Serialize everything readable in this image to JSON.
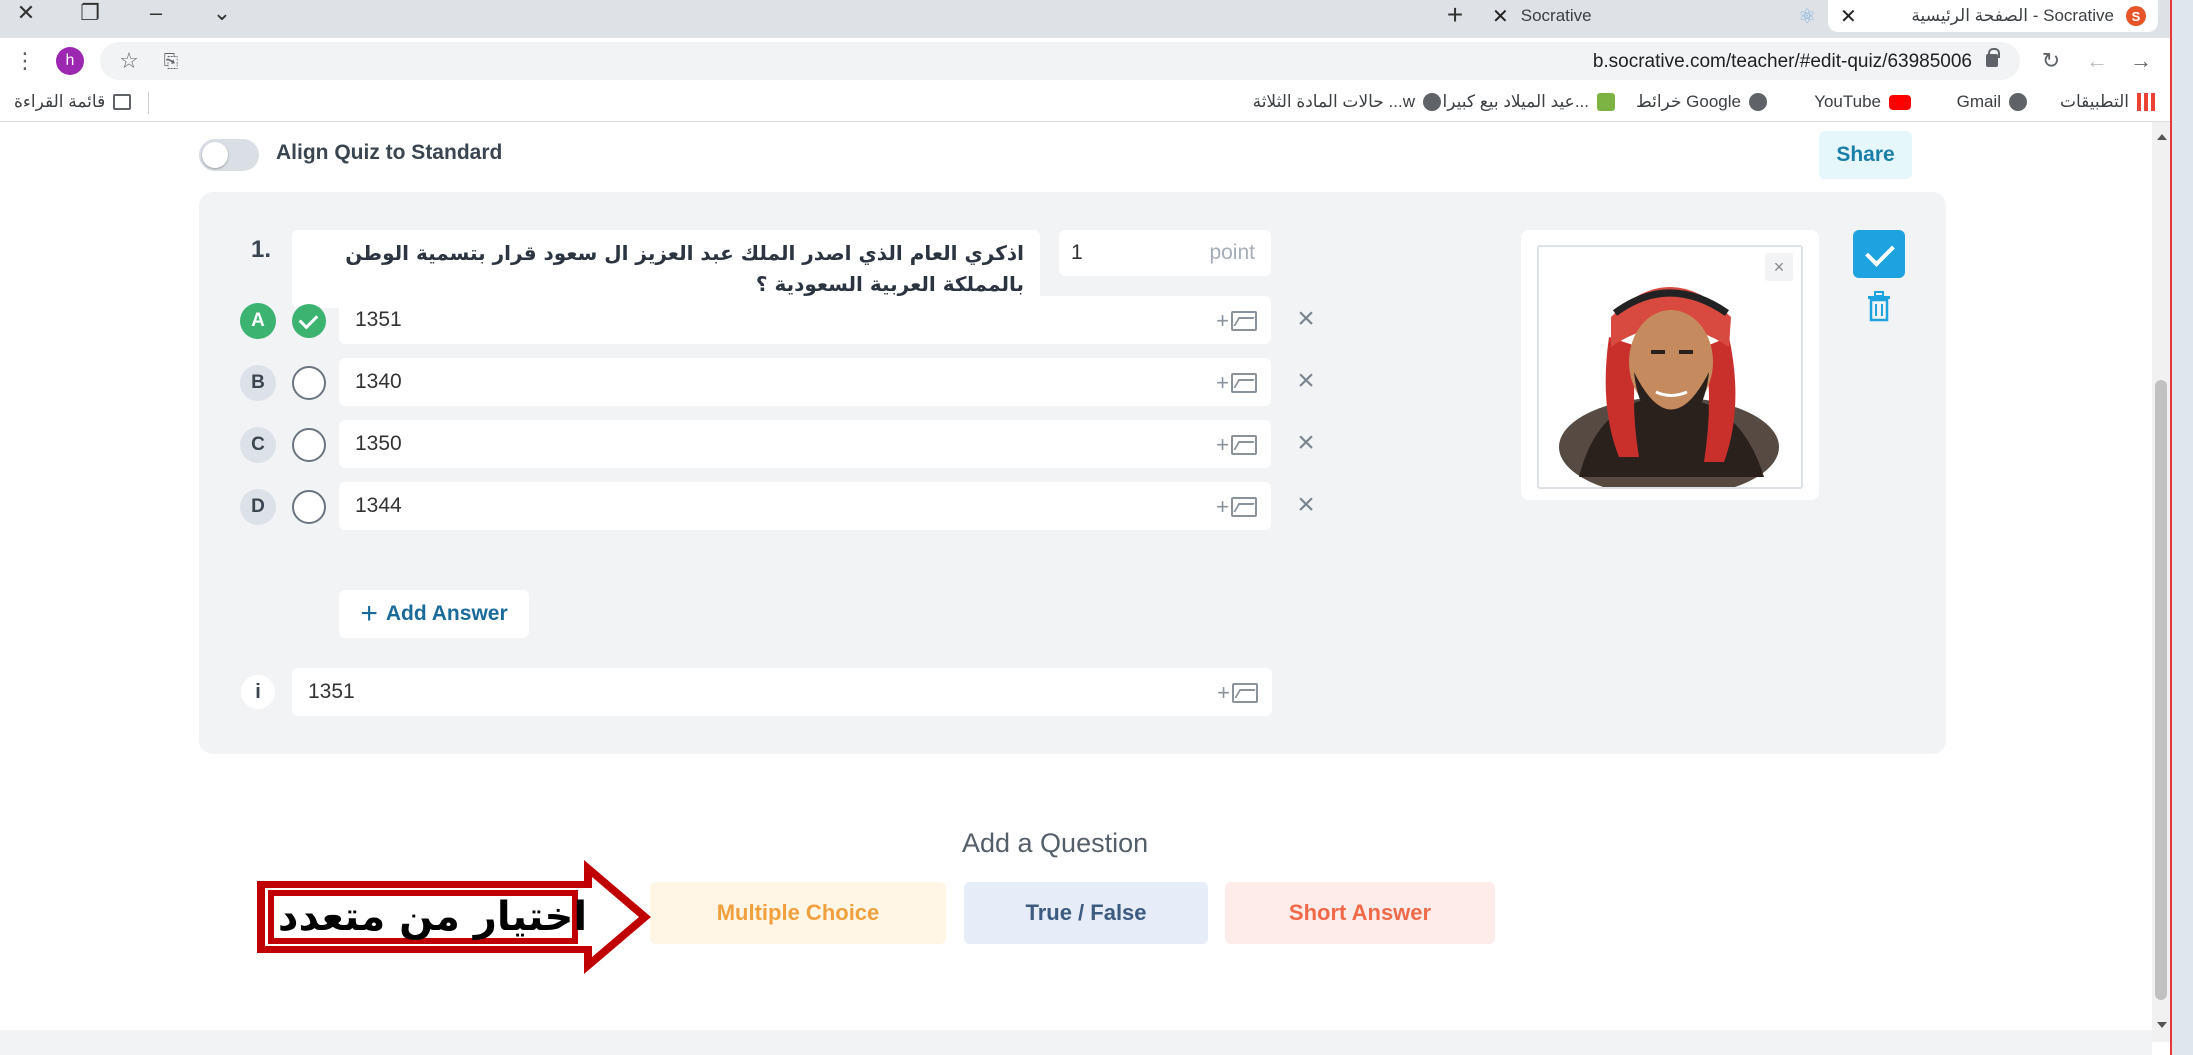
{
  "browser": {
    "tabs": [
      {
        "title": "Socrative",
        "favicon": "socrative-favicon"
      },
      {
        "title": "الصفحة الرئيسية - Socrative",
        "favicon": "socrative-favicon",
        "favicon_letter": "S"
      }
    ],
    "url": "b.socrative.com/teacher/#edit-quiz/63985006",
    "avatar_letter": "h",
    "bookmarks": [
      {
        "label": "التطبيقات",
        "icon": "apps-icon"
      },
      {
        "label": "Gmail",
        "icon": "globe-icon"
      },
      {
        "label": "YouTube",
        "icon": "youtube-icon"
      },
      {
        "label": "خرائط Google",
        "icon": "globe-icon"
      },
      {
        "label": "عيد الميلاد بيع كبيرا...",
        "icon": "bookmark-green-icon"
      },
      {
        "label": "حالات المادة الثلاثة ...w",
        "icon": "globe-icon"
      }
    ],
    "reading_list": "قائمة القراءة"
  },
  "quiz": {
    "align_label": "Align Quiz to Standard",
    "align_enabled": false,
    "share_label": "Share",
    "question": {
      "number": "1.",
      "text": "اذكري العام الذي اصدر الملك عبد العزيز ال سعود قرار بتسمية الوطن بالمملكة العربية السعودية ؟",
      "points_value": "1",
      "points_unit": "point",
      "answers": [
        {
          "letter": "A",
          "value": "1351",
          "correct": true
        },
        {
          "letter": "B",
          "value": "1340",
          "correct": false
        },
        {
          "letter": "C",
          "value": "1350",
          "correct": false
        },
        {
          "letter": "D",
          "value": "1344",
          "correct": false
        }
      ],
      "add_answer_label": "Add Answer",
      "explanation_icon": "i",
      "explanation": "1351",
      "image_close": "×"
    }
  },
  "add_question": {
    "title": "Add a Question",
    "types": [
      "Multiple Choice",
      "True / False",
      "Short Answer"
    ]
  },
  "annotation": {
    "callout_text": "اختيار من متعدد",
    "border_color": "#c00000"
  },
  "colors": {
    "correct": "#3cb371",
    "primary": "#1fa3e0",
    "mc": "#f2a03d",
    "tf": "#3d5a80",
    "sa": "#f06a4a"
  }
}
